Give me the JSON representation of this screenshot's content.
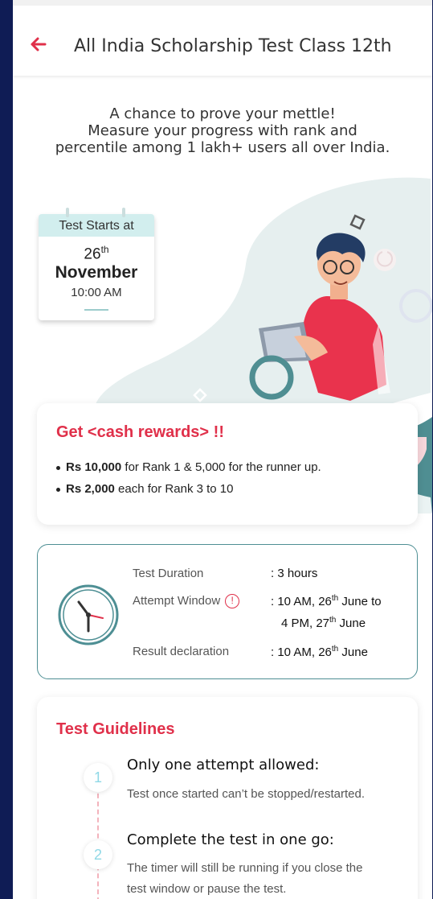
{
  "header": {
    "title": "All India Scholarship Test Class 12th",
    "back_icon": "arrow-left-icon",
    "accent": "#e0304a"
  },
  "intro": {
    "line1": "A chance to prove your mettle!",
    "line2": "Measure your progress with rank and",
    "line3": "percentile among 1 lakh+ users all over India."
  },
  "calendar": {
    "label": "Test Starts at",
    "day": "26",
    "day_suffix": "th",
    "month": "November",
    "time": "10:00 AM"
  },
  "rewards": {
    "title": "Get <cash rewards> !!",
    "item1_bold": "Rs 10,000",
    "item1_rest": " for Rank 1 & 5,000 for the runner up.",
    "item2_bold": "Rs 2,000",
    "item2_rest": " each for Rank 3 to 10"
  },
  "test_info": {
    "duration_label": "Test Duration",
    "duration_value": ": 3 hours",
    "window_label": "Attempt Window",
    "window_value_a": ": 10 AM, 26",
    "window_value_a_suffix": "th",
    "window_value_b": " June to",
    "window_value_c": "4 PM, 27",
    "window_value_c_suffix": "th",
    "window_value_d": " June",
    "result_label": "Result declaration",
    "result_value_a": ": 10 AM, 26",
    "result_value_a_suffix": "th",
    "result_value_b": " June",
    "clock_color": "#4e8f94"
  },
  "guidelines": {
    "title": "Test Guidelines",
    "steps": [
      {
        "num": "1",
        "title": "Only one attempt allowed:",
        "desc": "Test once started can’t be stopped/restarted."
      },
      {
        "num": "2",
        "title": "Complete the test in one go:",
        "desc_line1": "The timer will still be running if you close the",
        "desc_line2": "test window or pause the test."
      }
    ]
  }
}
